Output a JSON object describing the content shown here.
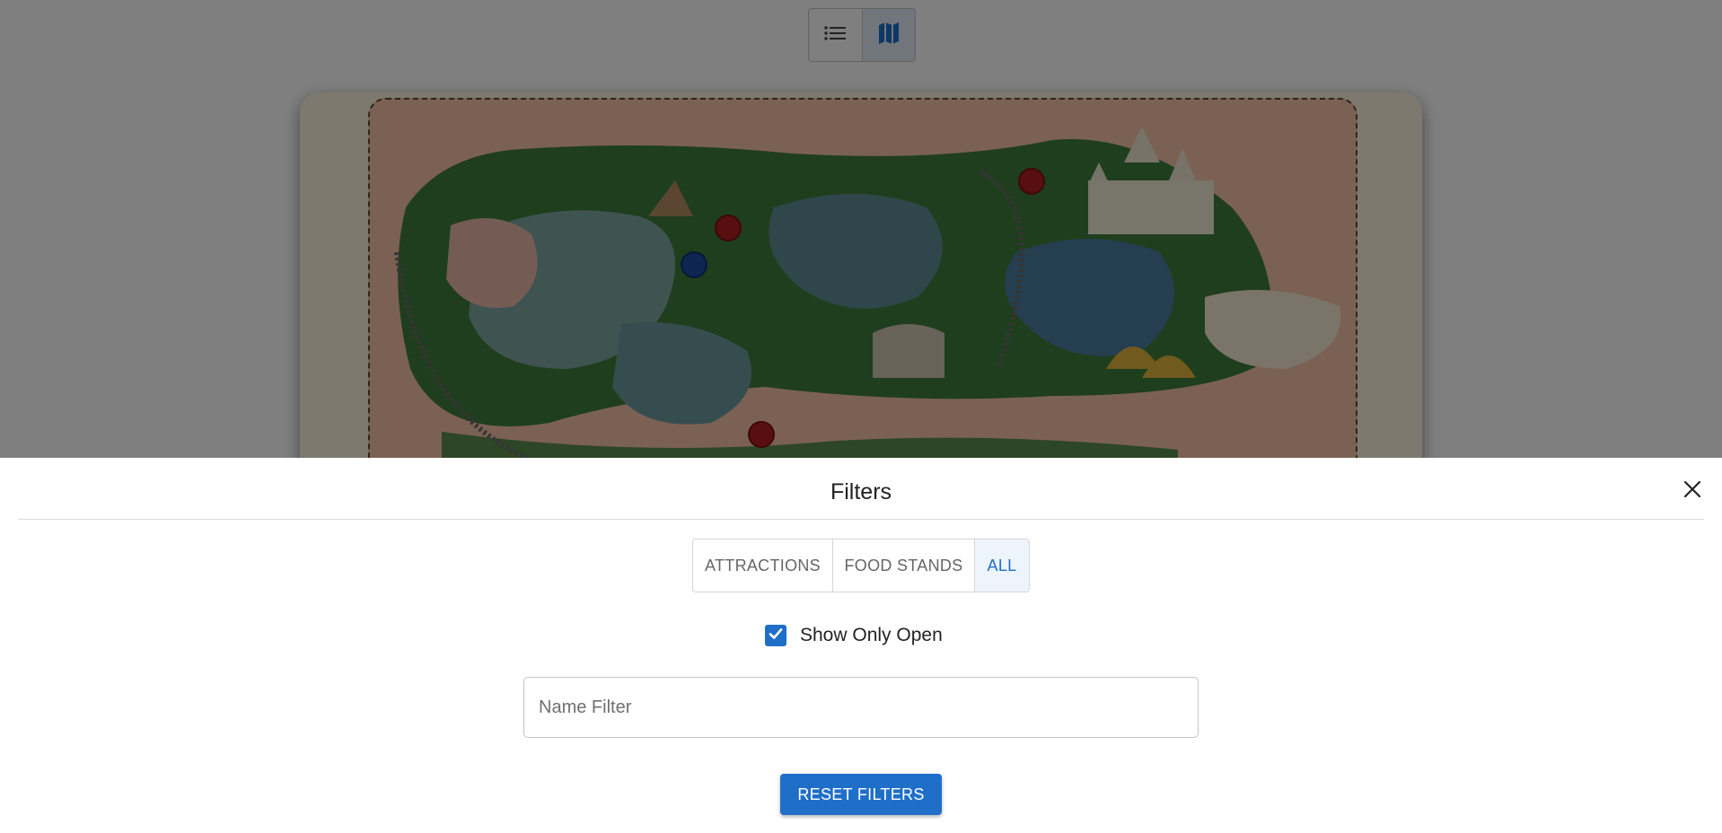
{
  "view_toggle": {
    "options": [
      {
        "icon": "list-icon",
        "selected": false
      },
      {
        "icon": "map-icon",
        "selected": true
      }
    ]
  },
  "map": {
    "markers": [
      {
        "type": "attraction",
        "color": "#b21e1e"
      },
      {
        "type": "attraction",
        "color": "#b21e1e"
      },
      {
        "type": "food-stand",
        "color": "#1d4aa3"
      },
      {
        "type": "attraction",
        "color": "#b21e1e"
      }
    ]
  },
  "filters_drawer": {
    "title": "Filters",
    "close_icon": "close-icon",
    "type_buttons": [
      {
        "label": "ATTRACTIONS",
        "active": false
      },
      {
        "label": "FOOD STANDS",
        "active": false
      },
      {
        "label": "ALL",
        "active": true
      }
    ],
    "show_only_open": {
      "label": "Show Only Open",
      "checked": true
    },
    "name_filter": {
      "placeholder": "Name Filter",
      "value": ""
    },
    "reset_label": "RESET FILTERS"
  },
  "colors": {
    "primary": "#1f6fc9",
    "active_button_bg": "#eef4fb",
    "overlay": "rgba(0,0,0,0.5)"
  }
}
